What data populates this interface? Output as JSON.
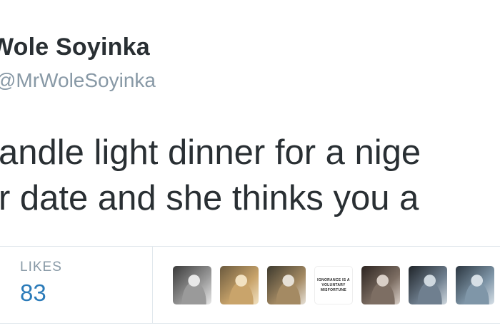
{
  "tweet": {
    "display_name": "Wole Soyinka",
    "handle": "@MrWoleSoyinka",
    "text_lines": [
      "andle light dinner for a nige",
      "r date and she thinks you a"
    ]
  },
  "stats": {
    "likes_label": "LIKES",
    "likes_count": "83"
  },
  "avatars": [
    {
      "name": "avatar-1",
      "colors": [
        "#3a3a3a",
        "#9a9a9a",
        "#e8e8e8"
      ]
    },
    {
      "name": "avatar-2",
      "colors": [
        "#6b5a3e",
        "#c9a46b",
        "#f2e2c2"
      ]
    },
    {
      "name": "avatar-3",
      "colors": [
        "#3e3a2e",
        "#a48a63",
        "#e6e0d6"
      ]
    },
    {
      "name": "avatar-4",
      "text": "IGNORANCE IS A\nVOLUNTARY\nMISFORTUNE"
    },
    {
      "name": "avatar-5",
      "colors": [
        "#2c2420",
        "#7d6e63",
        "#d9cfc7"
      ]
    },
    {
      "name": "avatar-6",
      "colors": [
        "#1f2429",
        "#6f7f8f",
        "#cfd8df"
      ]
    },
    {
      "name": "avatar-7",
      "colors": [
        "#2b3640",
        "#7f96a8",
        "#d6dfe6"
      ]
    }
  ]
}
